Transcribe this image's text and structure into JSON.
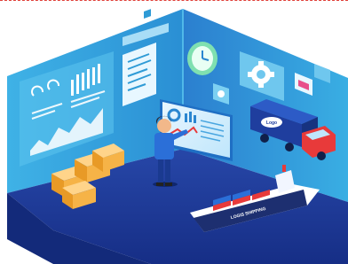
{
  "scene": {
    "truck_logo": "Logo",
    "ship_label": "LOGIS SHIPPING"
  },
  "colors": {
    "wall_left": "#2f9bd6",
    "wall_right": "#2a86d0",
    "floor": "#1d3f9a",
    "accent_red": "#e83a3a",
    "box": "#f0a02a"
  },
  "icons": [
    "clock-icon",
    "gear-icon",
    "settings-icon",
    "mail-icon",
    "chart-icon"
  ]
}
